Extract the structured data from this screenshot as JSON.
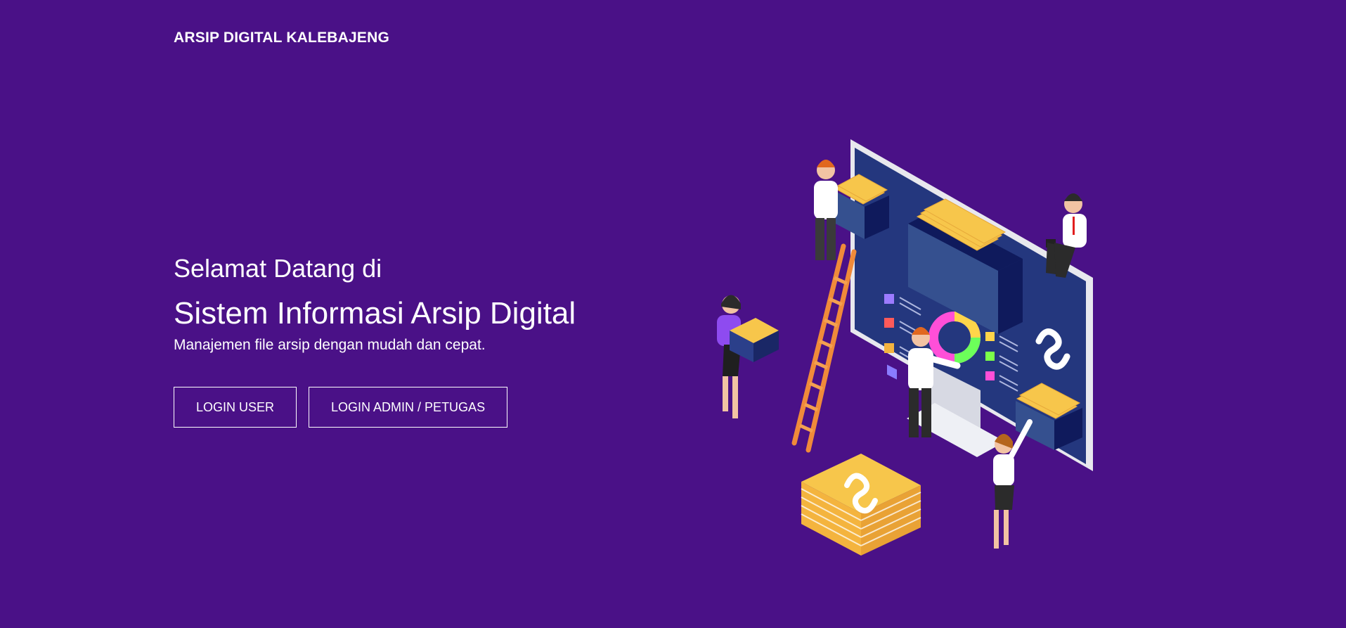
{
  "header": {
    "brand": "ARSIP DIGITAL KALEBAJENG"
  },
  "hero": {
    "welcome": "Selamat Datang di",
    "title": "Sistem Informasi Arsip Digital",
    "subtitle": "Manajemen file arsip dengan mudah dan cepat.",
    "buttons": {
      "login_user": "LOGIN USER",
      "login_admin": "LOGIN ADMIN / PETUGAS"
    }
  },
  "illustration": {
    "icon": "archive-team-illustration-icon"
  },
  "colors": {
    "background": "#4a1187",
    "text": "#ffffff",
    "monitor": "#24377e",
    "folder": "#f7c64b"
  }
}
